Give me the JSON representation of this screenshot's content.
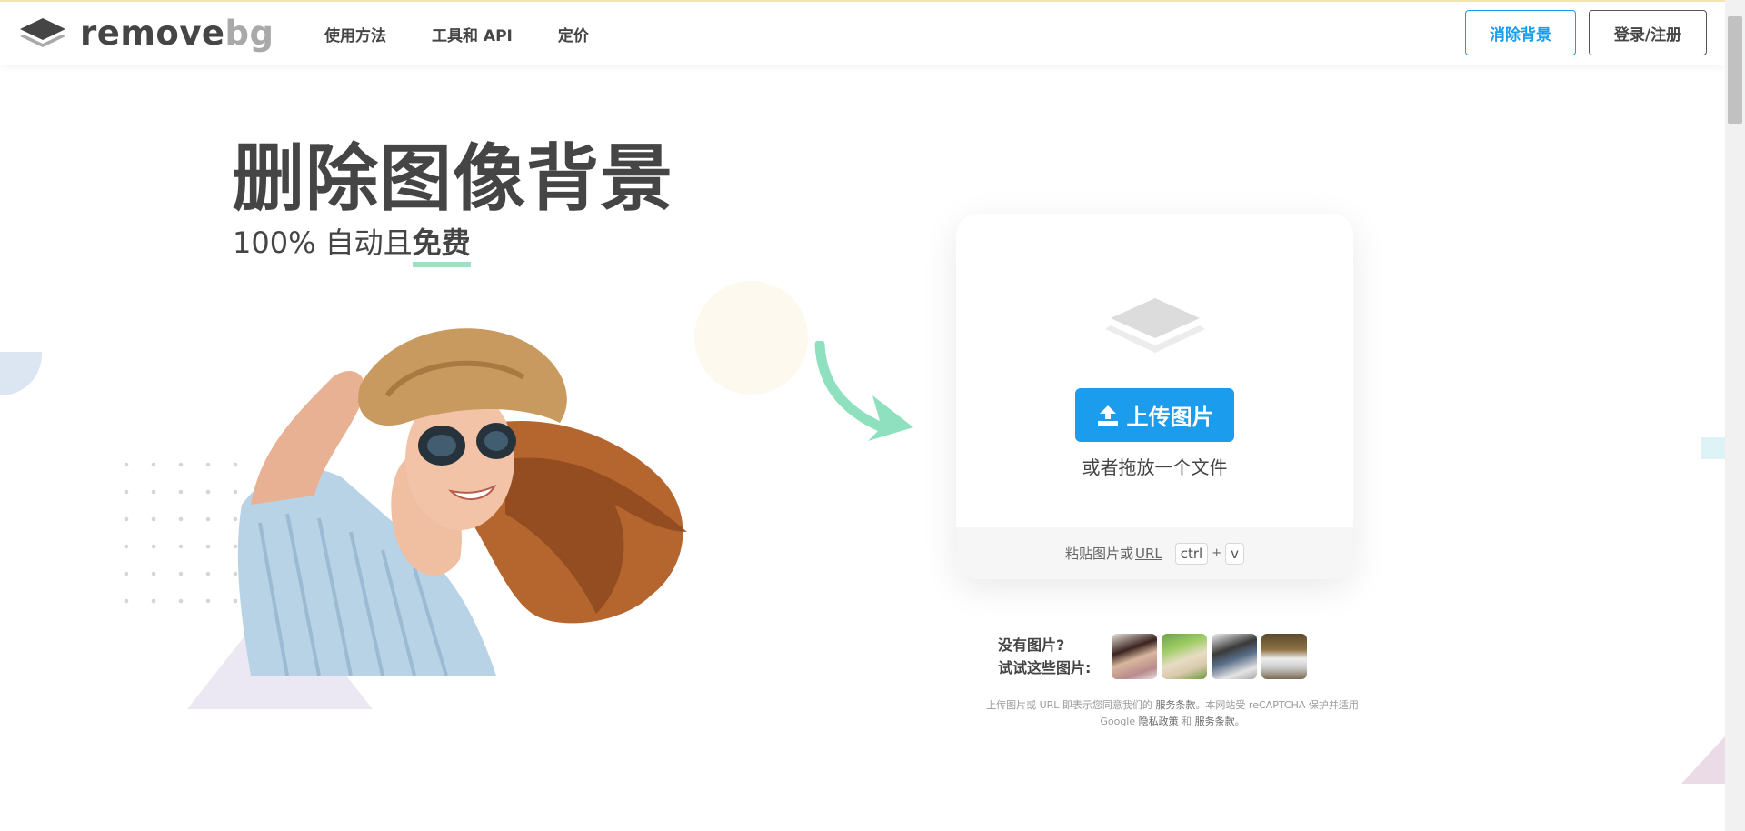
{
  "header": {
    "logo": {
      "text_a": "remove",
      "text_b": "bg"
    },
    "nav": [
      {
        "label": "使用方法"
      },
      {
        "label": "工具和 API"
      },
      {
        "label": "定价"
      }
    ],
    "remove_bg_button": "消除背景",
    "login_button": "登录/注册"
  },
  "hero": {
    "title": "删除图像背景",
    "subtitle_prefix": "100% 自动且",
    "subtitle_emphasis": "免费"
  },
  "upload_card": {
    "upload_button": "上传图片",
    "drop_text": "或者拖放一个文件",
    "paste_text": "粘贴图片或",
    "url_link": "URL",
    "key_ctrl": "ctrl",
    "key_plus": "+",
    "key_v": "v"
  },
  "samples": {
    "label_line1": "没有图片?",
    "label_line2": "试试这些图片:"
  },
  "legal": {
    "part1": "上传图片或 URL 即表示您同意我们的",
    "terms1": "服务条款",
    "part2": "。本网站受 reCAPTCHA 保护并适用",
    "part3": "Google",
    "privacy": "隐私政策",
    "part4": "和",
    "terms2": "服务条款",
    "part5": "。"
  },
  "colors": {
    "accent": "#1c9cec",
    "text": "#454545",
    "underline": "#9ce2c2",
    "arrow": "#8ee0bf"
  },
  "icons": [
    "layers-logo-icon",
    "upload-icon",
    "arrow-icon"
  ]
}
